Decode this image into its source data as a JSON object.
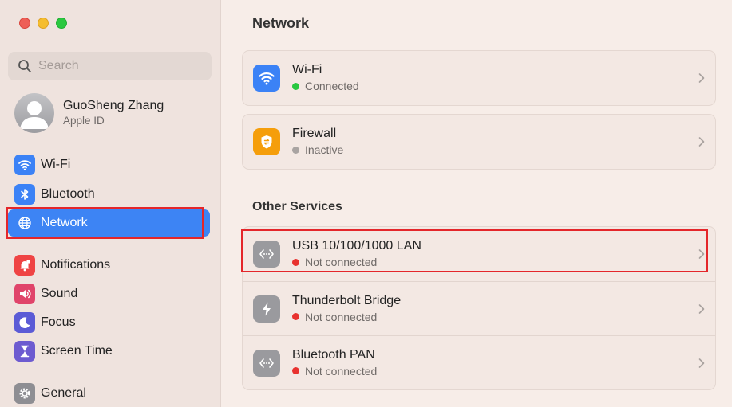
{
  "search": {
    "placeholder": "Search"
  },
  "account": {
    "name": "GuoSheng Zhang",
    "subtitle": "Apple ID"
  },
  "sidebar": {
    "items": [
      {
        "label": "Wi-Fi",
        "icon": "wifi-icon",
        "color": "#3b82f6"
      },
      {
        "label": "Bluetooth",
        "icon": "bluetooth-icon",
        "color": "#3b82f6"
      },
      {
        "label": "Network",
        "icon": "globe-icon",
        "color": "#3d84f4",
        "selected": true
      },
      {
        "label": "Notifications",
        "icon": "bell-icon",
        "color": "#ef4444"
      },
      {
        "label": "Sound",
        "icon": "speaker-icon",
        "color": "#e0446a"
      },
      {
        "label": "Focus",
        "icon": "moon-icon",
        "color": "#5b5bd6"
      },
      {
        "label": "Screen Time",
        "icon": "hourglass-icon",
        "color": "#6d5bd0"
      },
      {
        "label": "General",
        "icon": "gear-icon",
        "color": "#8e8e93"
      }
    ]
  },
  "main": {
    "title": "Network",
    "services": [
      {
        "title": "Wi-Fi",
        "status": "Connected",
        "status_color": "#28c840",
        "icon": "wifi-icon"
      },
      {
        "title": "Firewall",
        "status": "Inactive",
        "status_color": "#a9a4a2",
        "icon": "firewall-icon"
      }
    ],
    "other_title": "Other Services",
    "other_services": [
      {
        "title": "USB 10/100/1000 LAN",
        "status": "Not connected",
        "status_color": "#e8322f",
        "icon": "ethernet-icon"
      },
      {
        "title": "Thunderbolt Bridge",
        "status": "Not connected",
        "status_color": "#e8322f",
        "icon": "thunderbolt-icon"
      },
      {
        "title": "Bluetooth PAN",
        "status": "Not connected",
        "status_color": "#e8322f",
        "icon": "ethernet-icon"
      }
    ]
  },
  "colors": {
    "accent": "#3d84f4",
    "highlight": "#e4262a"
  }
}
